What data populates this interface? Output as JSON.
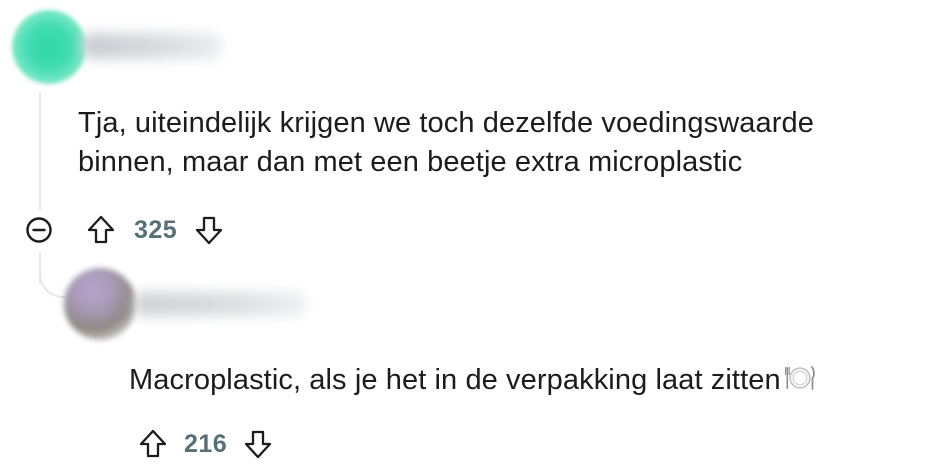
{
  "comments": [
    {
      "text_lines": [
        "Tja, uiteindelijk krijgen we toch dezelfde voedingswaarde",
        "binnen, maar dan met een beetje extra microplastic"
      ],
      "score": "325"
    },
    {
      "text": "Macroplastic, als je het in de verpakking laat zitten",
      "emoji": "plate-with-cutlery-icon",
      "score": "216"
    }
  ],
  "colors": {
    "text": "#1c1c1c",
    "meta": "#576f76",
    "thread_line": "#e5e7e8",
    "avatar_1": "#41dcb0"
  }
}
